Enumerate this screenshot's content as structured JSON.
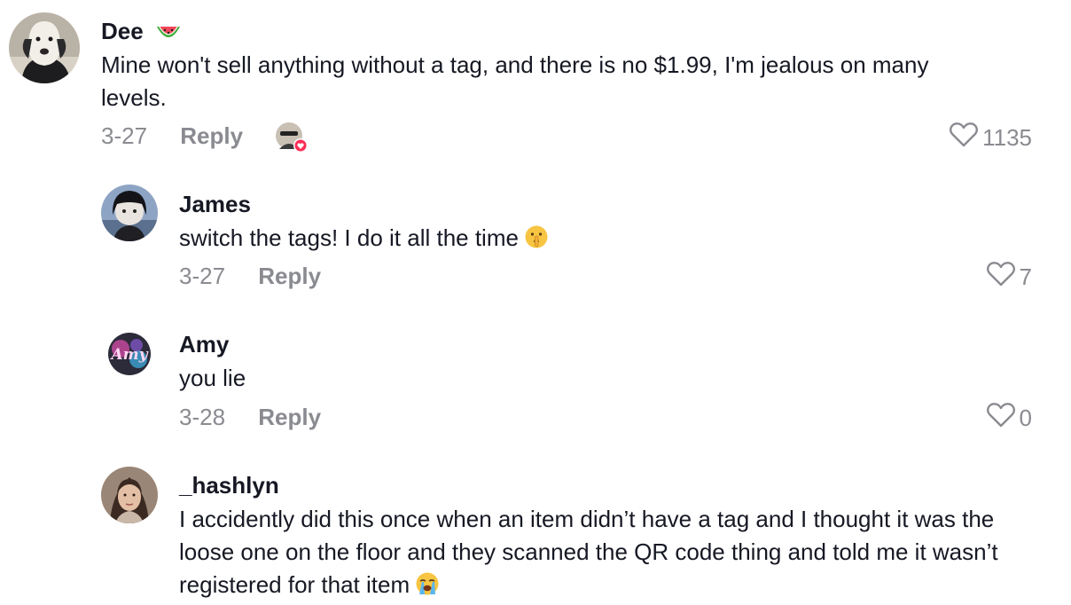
{
  "comments": [
    {
      "username": "Dee",
      "text": "Mine won't sell anything without a tag, and there is no $1.99, I'm jealous on many levels.",
      "date": "3-27",
      "reply_label": "Reply",
      "likes": "1135",
      "username_emoji": "watermelon-icon",
      "creator_liked": true
    },
    {
      "username": "James",
      "text": "switch the tags! I do it all the time",
      "text_emoji": "shushing-face-icon",
      "date": "3-27",
      "reply_label": "Reply",
      "likes": "7"
    },
    {
      "username": "Amy",
      "text": "you lie",
      "date": "3-28",
      "reply_label": "Reply",
      "likes": "0",
      "avatar_text": "Amy"
    },
    {
      "username": "_hashlyn",
      "text": "I accidently did this once when an item didn’t have a tag and I thought it was the loose one on the floor and they scanned the QR code thing and told me it wasn’t registered for that item",
      "text_emoji": "loudly-crying-face-icon"
    }
  ],
  "colors": {
    "text": "#161823",
    "meta": "#8a8b91",
    "heart_badge": "#fe2c55"
  }
}
